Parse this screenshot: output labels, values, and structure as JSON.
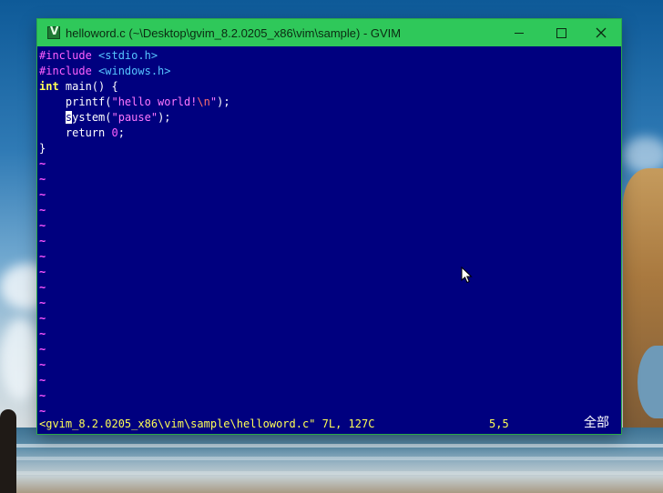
{
  "window": {
    "title": "helloword.c (~\\Desktop\\gvim_8.2.0205_x86\\vim\\sample) - GVIM",
    "controls": {
      "minimize": "minimize",
      "maximize": "maximize",
      "close": "close"
    }
  },
  "editor": {
    "lines": [
      [
        {
          "t": "#include ",
          "c": "pre"
        },
        {
          "t": "<stdio.h>",
          "c": "hdr"
        }
      ],
      [
        {
          "t": "#include ",
          "c": "pre"
        },
        {
          "t": "<windows.h>",
          "c": "hdr"
        }
      ],
      [
        {
          "t": "int",
          "c": "type"
        },
        {
          "t": " main() {",
          "c": "plain"
        }
      ],
      [
        {
          "t": "    printf(",
          "c": "plain"
        },
        {
          "t": "\"hello world!",
          "c": "str"
        },
        {
          "t": "\\n",
          "c": "esc"
        },
        {
          "t": "\"",
          "c": "str"
        },
        {
          "t": ");",
          "c": "plain"
        }
      ],
      [
        {
          "t": "    ",
          "c": "plain"
        },
        {
          "t": "s",
          "c": "plain cursor"
        },
        {
          "t": "ystem(",
          "c": "plain"
        },
        {
          "t": "\"pause\"",
          "c": "str"
        },
        {
          "t": ");",
          "c": "plain"
        }
      ],
      [
        {
          "t": "    return ",
          "c": "plain"
        },
        {
          "t": "0",
          "c": "num"
        },
        {
          "t": ";",
          "c": "plain"
        }
      ],
      [
        {
          "t": "}",
          "c": "plain"
        }
      ]
    ],
    "tilde_char": "~",
    "tilde_count": 17,
    "status_file": "<gvim_8.2.0205_x86\\vim\\sample\\helloword.c\" 7L, 127C",
    "cursor_pos": "5,5",
    "scroll_pos": "全部"
  },
  "colors": {
    "titlebar": "#2fc85a",
    "editor_bg": "#00007f",
    "preproc": "#ff60ff",
    "header": "#56c4ff",
    "type": "#ffff55"
  },
  "icons": {
    "app": "gvim-icon",
    "pointer": "mouse-pointer-icon"
  }
}
